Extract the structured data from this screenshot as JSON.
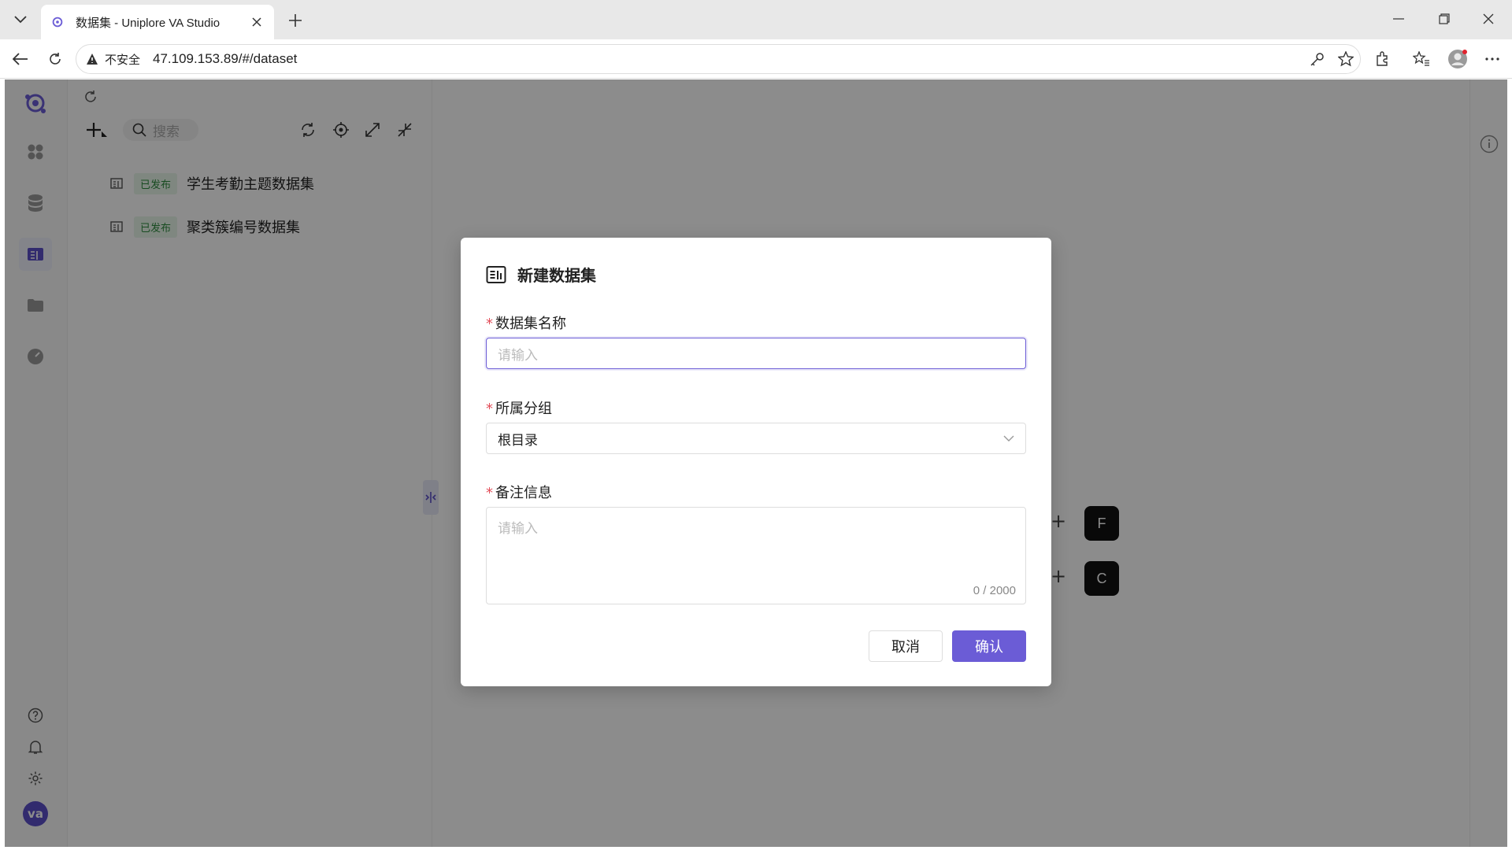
{
  "browser": {
    "tab_title": "数据集 - Uniplore VA Studio",
    "insecure_label": "不安全",
    "url": "47.109.153.89/#/dataset"
  },
  "sidebar": {
    "avatar_text": "va"
  },
  "panel": {
    "search_placeholder": "搜索",
    "items": [
      {
        "badge": "已发布",
        "name": "学生考勤主题数据集"
      },
      {
        "badge": "已发布",
        "name": "聚类簇编号数据集"
      }
    ]
  },
  "hotkeys": [
    {
      "key": "F"
    },
    {
      "key": "C"
    }
  ],
  "modal": {
    "title": "新建数据集",
    "name_label": "数据集名称",
    "name_placeholder": "请输入",
    "group_label": "所属分组",
    "group_value": "根目录",
    "remark_label": "备注信息",
    "remark_placeholder": "请输入",
    "remark_counter": "0 / 2000",
    "cancel_label": "取消",
    "confirm_label": "确认"
  },
  "colors": {
    "accent": "#6b5cd6",
    "published_bg": "#e8f6ea",
    "published_text": "#2e8b3e",
    "required": "#e34d59"
  }
}
